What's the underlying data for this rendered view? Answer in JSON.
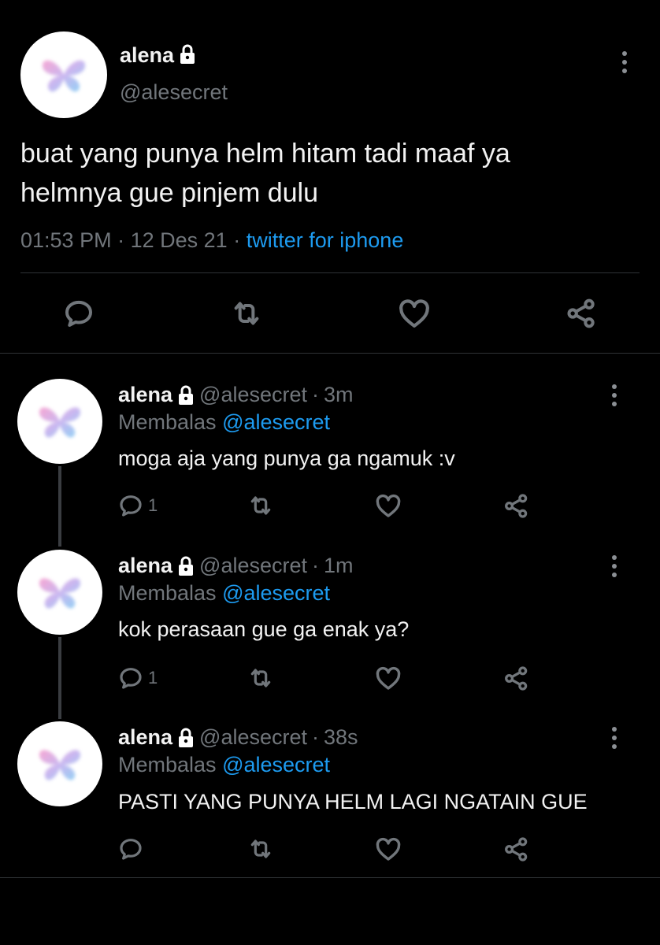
{
  "main_tweet": {
    "name": "alena",
    "handle": "@alesecret",
    "text_line1": "buat yang punya helm hitam tadi maaf ya",
    "text_line2": "helmnya gue pinjem dulu",
    "time": "01:53 PM",
    "date": "12 Des 21",
    "source": "twitter for iphone",
    "separator": "·"
  },
  "replies": [
    {
      "name": "alena",
      "handle": "@alesecret",
      "age": "3m",
      "replying_label": "Membalas",
      "replying_to": "@alesecret",
      "text": "moga aja yang punya ga ngamuk :v",
      "reply_count": "1"
    },
    {
      "name": "alena",
      "handle": "@alesecret",
      "age": "1m",
      "replying_label": "Membalas",
      "replying_to": "@alesecret",
      "text": "kok perasaan gue ga enak ya?",
      "reply_count": "1"
    },
    {
      "name": "alena",
      "handle": "@alesecret",
      "age": "38s",
      "replying_label": "Membalas",
      "replying_to": "@alesecret",
      "text": "PASTI YANG PUNYA HELM LAGI NGATAIN GUE",
      "reply_count": ""
    }
  ],
  "icons": [
    "lock-icon",
    "more-icon",
    "reply-icon",
    "retweet-icon",
    "like-icon",
    "share-icon",
    "butterfly-avatar-icon"
  ],
  "colors": {
    "background": "#000000",
    "link": "#1d9bf0",
    "muted": "#71767b",
    "divider": "#2f3336"
  }
}
